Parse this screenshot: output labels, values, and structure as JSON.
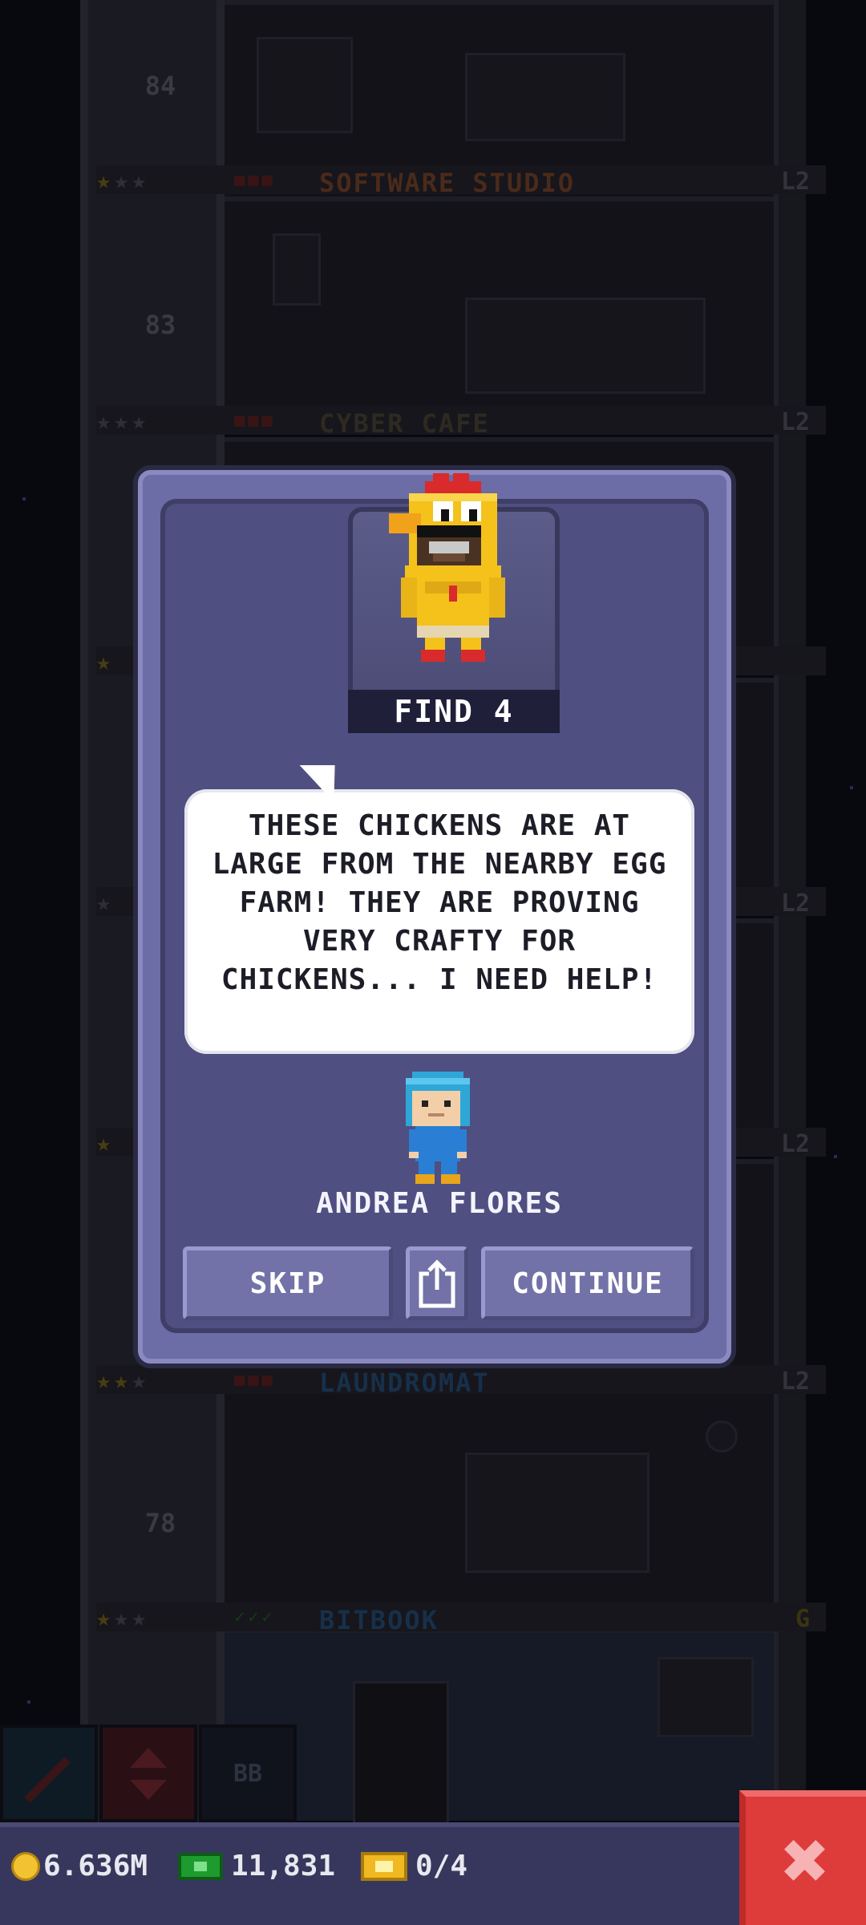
{
  "tower": {
    "floors": [
      {
        "number": "84",
        "band_name": "SOFTWARE STUDIO",
        "band_color": "#4a2a1a",
        "level": "L2",
        "stars": 1,
        "marks": "■■■"
      },
      {
        "number": "83",
        "band_name": "CYBER CAFE",
        "band_color": "#2e2a22",
        "level": "L2",
        "stars": 0,
        "marks": "■■■"
      },
      {
        "number": "",
        "band_name": "",
        "band_color": "#2e2a22",
        "level": "",
        "stars": 1,
        "marks": ""
      },
      {
        "number": "",
        "band_name": "",
        "band_color": "#2e2a22",
        "level": "L2",
        "stars": 0,
        "marks": ""
      },
      {
        "number": "",
        "band_name": "",
        "band_color": "#2e2a22",
        "level": "L2",
        "stars": 1,
        "marks": ""
      },
      {
        "number": "78",
        "band_name": "LAUNDROMAT",
        "band_color": "#17304a",
        "level": "L2",
        "stars": 2,
        "marks": "■■■"
      },
      {
        "number": "",
        "band_name": "BITBOOK",
        "band_color": "#17304a",
        "level": "G",
        "stars": 1,
        "marks": "✓✓✓"
      }
    ],
    "toolbar_label": "BB"
  },
  "status": {
    "coins": "6.636M",
    "bux": "11,831",
    "tickets": "0/4"
  },
  "dialog": {
    "find_label": "FIND 4",
    "message": "THESE CHICKENS ARE AT LARGE FROM THE NEARBY EGG FARM! THEY ARE PROVING VERY CRAFTY FOR CHICKENS... I NEED HELP!",
    "npc_name": "ANDREA FLORES",
    "skip_label": "SKIP",
    "continue_label": "CONTINUE"
  },
  "colors": {
    "dialog_bg": "#4f4f81",
    "button": "#7272a8",
    "close_button": "#de3b3b",
    "status_bar": "#37375d"
  },
  "icons": [
    "share-icon",
    "close-icon",
    "coin-icon",
    "bux-icon",
    "ticket-icon"
  ]
}
